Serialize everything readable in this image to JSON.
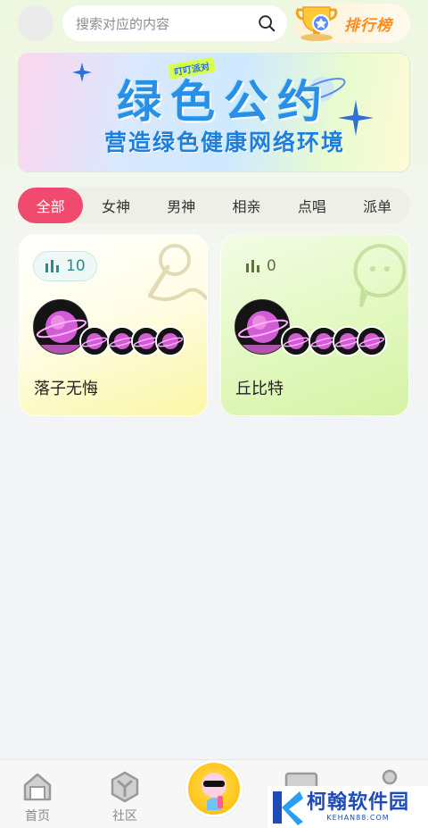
{
  "header": {
    "search_placeholder": "搜索对应的内容",
    "search_icon": "search-icon",
    "ranking_label": "排行榜",
    "ranking_icon": "trophy-icon"
  },
  "banner": {
    "tag": "叮叮派对",
    "title": "绿色公约",
    "subtitle": "营造绿色健康网络环境"
  },
  "tabs": [
    {
      "label": "全部",
      "active": true
    },
    {
      "label": "女神",
      "active": false
    },
    {
      "label": "男神",
      "active": false
    },
    {
      "label": "相亲",
      "active": false
    },
    {
      "label": "点唱",
      "active": false
    },
    {
      "label": "派单",
      "active": false
    }
  ],
  "rooms": [
    {
      "name": "落子无悔",
      "count": "10",
      "deco_icon": "microphone-icon",
      "accent": "#2d8a8a"
    },
    {
      "name": "丘比特",
      "count": "0",
      "deco_icon": "chat-bubble-icon",
      "accent": "#5e7240"
    }
  ],
  "bottom_nav": {
    "items": [
      {
        "label": "首页",
        "icon": "home-icon"
      },
      {
        "label": "社区",
        "icon": "community-icon"
      }
    ],
    "center_icon": "party-mascot-icon"
  },
  "watermark": {
    "title": "柯翰软件园",
    "subtitle": "KEHAN88.COM"
  },
  "colors": {
    "accent": "#f04a6e",
    "banner_blue": "#2a8fe6",
    "ranking_orange": "#ff8a1e"
  }
}
